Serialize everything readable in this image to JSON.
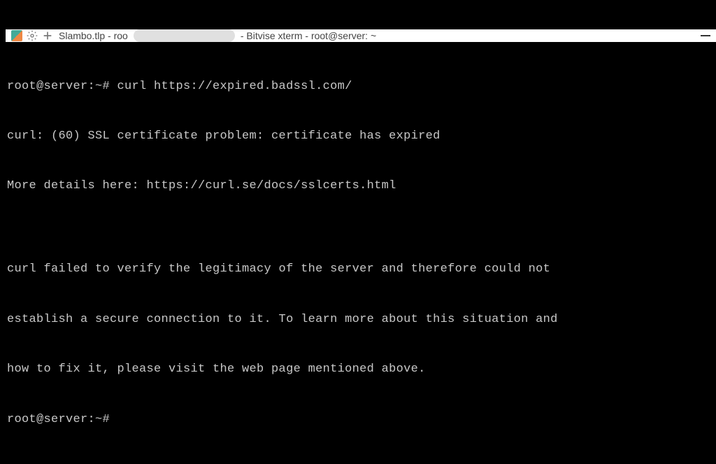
{
  "titlebar": {
    "title_left": "Slambo.tlp - roo",
    "title_right": "- Bitvise xterm - root@server: ~"
  },
  "terminal": {
    "lines": [
      "root@server:~# curl https://expired.badssl.com/",
      "curl: (60) SSL certificate problem: certificate has expired",
      "More details here: https://curl.se/docs/sslcerts.html",
      "",
      "curl failed to verify the legitimacy of the server and therefore could not",
      "establish a secure connection to it. To learn more about this situation and",
      "how to fix it, please visit the web page mentioned above.",
      "root@server:~#"
    ]
  }
}
